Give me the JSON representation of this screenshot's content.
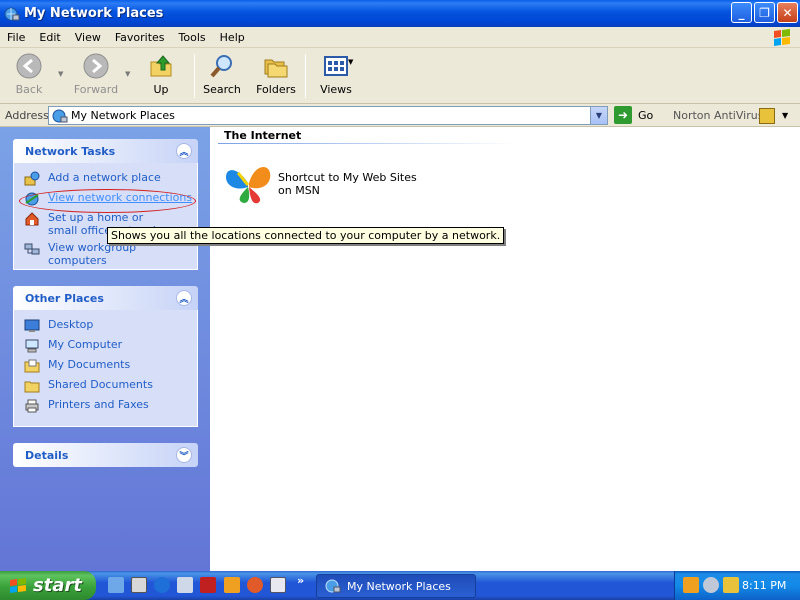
{
  "window": {
    "title": "My Network Places",
    "controls": {
      "minimize": "_",
      "maximize": "❐",
      "close": "✕"
    }
  },
  "menu": [
    "File",
    "Edit",
    "View",
    "Favorites",
    "Tools",
    "Help"
  ],
  "toolbar": {
    "back": "Back",
    "forward": "Forward",
    "up": "Up",
    "search": "Search",
    "folders": "Folders",
    "views": "Views"
  },
  "address": {
    "label": "Address",
    "value": "My Network Places",
    "go": "Go",
    "norton": "Norton AntiVirus"
  },
  "network_tasks": {
    "title": "Network Tasks",
    "items": [
      "Add a network place",
      "View network connections",
      "Set up a home or small office network",
      "View workgroup computers"
    ]
  },
  "other_places": {
    "title": "Other Places",
    "items": [
      "Desktop",
      "My Computer",
      "My Documents",
      "Shared Documents",
      "Printers and Faxes"
    ]
  },
  "details": {
    "title": "Details"
  },
  "main": {
    "group_title": "The Internet",
    "shortcut_label": "Shortcut to My Web Sites on MSN"
  },
  "tooltip": "Shows you all the locations connected to your computer by a network.",
  "taskbar": {
    "start": "start",
    "task_item": "My Network Places",
    "clock": "8:11 PM"
  },
  "colors": {
    "titlebar": "#0453df",
    "task_link": "#215dc6",
    "annotation": "#d42020"
  }
}
